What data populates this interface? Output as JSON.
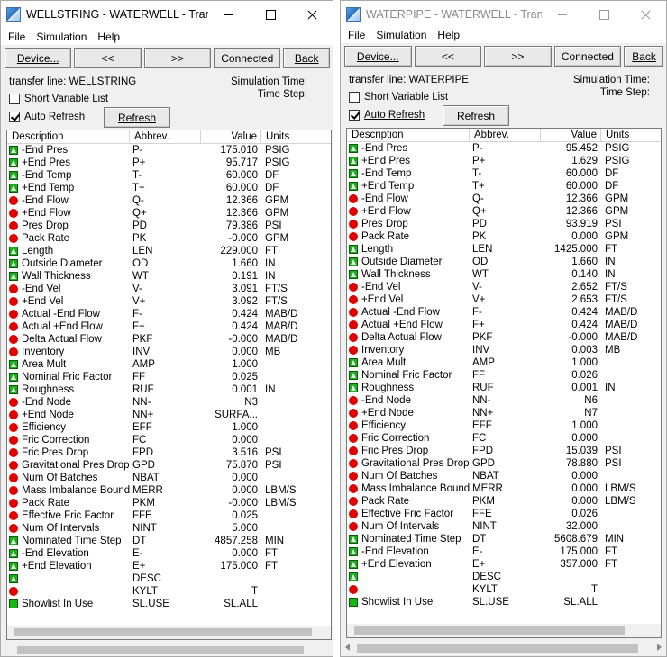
{
  "left": {
    "title": "WELLSTRING - WATERWELL - Trans",
    "menu": [
      "File",
      "Simulation",
      "Help"
    ],
    "toolbar": {
      "device": "Device...",
      "prev": "<<",
      "next": ">>",
      "connected": "Connected",
      "back": "Back"
    },
    "transfer_line": "transfer line: WELLSTRING",
    "sim_time_label": "Simulation Time:",
    "time_step_label": "Time Step:",
    "short_list_label": "Short Variable List",
    "short_list_checked": false,
    "auto_refresh_label": "Auto Refresh",
    "auto_refresh_checked": true,
    "refresh_label": "Refresh",
    "columns": [
      "Description",
      "Abbrev.",
      "Value",
      "Units"
    ],
    "rows": [
      {
        "icon": "param",
        "desc": "-End Pres",
        "abbr": "P-",
        "val": "175.010",
        "unit": "PSIG"
      },
      {
        "icon": "param",
        "desc": "+End Pres",
        "abbr": "P+",
        "val": "95.717",
        "unit": "PSIG"
      },
      {
        "icon": "param",
        "desc": "-End Temp",
        "abbr": "T-",
        "val": "60.000",
        "unit": "DF"
      },
      {
        "icon": "param",
        "desc": "+End Temp",
        "abbr": "T+",
        "val": "60.000",
        "unit": "DF"
      },
      {
        "icon": "calc",
        "desc": "-End Flow",
        "abbr": "Q-",
        "val": "12.366",
        "unit": "GPM"
      },
      {
        "icon": "calc",
        "desc": "+End Flow",
        "abbr": "Q+",
        "val": "12.366",
        "unit": "GPM"
      },
      {
        "icon": "calc",
        "desc": "Pres Drop",
        "abbr": "PD",
        "val": "79.386",
        "unit": "PSI"
      },
      {
        "icon": "calc",
        "desc": "Pack Rate",
        "abbr": "PK",
        "val": "-0.000",
        "unit": "GPM"
      },
      {
        "icon": "param",
        "desc": "Length",
        "abbr": "LEN",
        "val": "229.000",
        "unit": "FT"
      },
      {
        "icon": "param",
        "desc": "Outside Diameter",
        "abbr": "OD",
        "val": "1.660",
        "unit": "IN"
      },
      {
        "icon": "param",
        "desc": "Wall Thickness",
        "abbr": "WT",
        "val": "0.191",
        "unit": "IN"
      },
      {
        "icon": "calc",
        "desc": "-End Vel",
        "abbr": "V-",
        "val": "3.091",
        "unit": "FT/S"
      },
      {
        "icon": "calc",
        "desc": "+End Vel",
        "abbr": "V+",
        "val": "3.092",
        "unit": "FT/S"
      },
      {
        "icon": "calc",
        "desc": "Actual -End Flow",
        "abbr": "F-",
        "val": "0.424",
        "unit": "MAB/D"
      },
      {
        "icon": "calc",
        "desc": "Actual +End Flow",
        "abbr": "F+",
        "val": "0.424",
        "unit": "MAB/D"
      },
      {
        "icon": "calc",
        "desc": "Delta Actual Flow",
        "abbr": "PKF",
        "val": "-0.000",
        "unit": "MAB/D"
      },
      {
        "icon": "calc",
        "desc": "Inventory",
        "abbr": "INV",
        "val": "0.000",
        "unit": "MB"
      },
      {
        "icon": "param",
        "desc": "Area Mult",
        "abbr": "AMP",
        "val": "1.000",
        "unit": ""
      },
      {
        "icon": "param",
        "desc": "Nominal Fric Factor",
        "abbr": "FF",
        "val": "0.025",
        "unit": ""
      },
      {
        "icon": "param",
        "desc": "Roughness",
        "abbr": "RUF",
        "val": "0.001",
        "unit": "IN"
      },
      {
        "icon": "calc",
        "desc": "-End Node",
        "abbr": "NN-",
        "val": "N3",
        "unit": ""
      },
      {
        "icon": "calc",
        "desc": "+End Node",
        "abbr": "NN+",
        "val": "SURFA...",
        "unit": ""
      },
      {
        "icon": "calc",
        "desc": "Efficiency",
        "abbr": "EFF",
        "val": "1.000",
        "unit": ""
      },
      {
        "icon": "calc",
        "desc": "Fric Correction",
        "abbr": "FC",
        "val": "0.000",
        "unit": ""
      },
      {
        "icon": "calc",
        "desc": "Fric Pres Drop",
        "abbr": "FPD",
        "val": "3.516",
        "unit": "PSI"
      },
      {
        "icon": "calc",
        "desc": "Gravitational Pres Drop",
        "abbr": "GPD",
        "val": "75.870",
        "unit": "PSI"
      },
      {
        "icon": "calc",
        "desc": "Num Of Batches",
        "abbr": "NBAT",
        "val": "0.000",
        "unit": ""
      },
      {
        "icon": "calc",
        "desc": "Mass Imbalance Bound",
        "abbr": "MERR",
        "val": "0.000",
        "unit": "LBM/S"
      },
      {
        "icon": "calc",
        "desc": "Pack Rate",
        "abbr": "PKM",
        "val": "-0.000",
        "unit": "LBM/S"
      },
      {
        "icon": "calc",
        "desc": "Effective Fric Factor",
        "abbr": "FFE",
        "val": "0.025",
        "unit": ""
      },
      {
        "icon": "calc",
        "desc": "Num Of Intervals",
        "abbr": "NINT",
        "val": "5.000",
        "unit": ""
      },
      {
        "icon": "param",
        "desc": "Nominated Time Step",
        "abbr": "DT",
        "val": "4857.258",
        "unit": "MIN"
      },
      {
        "icon": "param",
        "desc": "-End Elevation",
        "abbr": "E-",
        "val": "0.000",
        "unit": "FT"
      },
      {
        "icon": "param",
        "desc": "+End Elevation",
        "abbr": "E+",
        "val": "175.000",
        "unit": "FT"
      },
      {
        "icon": "param",
        "desc": "",
        "abbr": "DESC",
        "val": "",
        "unit": ""
      },
      {
        "icon": "calc",
        "desc": "",
        "abbr": "KYLT",
        "val": "T",
        "unit": ""
      },
      {
        "icon": "flag",
        "desc": "Showlist In Use",
        "abbr": "SL.USE",
        "val": "SL.ALL",
        "unit": ""
      }
    ]
  },
  "right": {
    "title": "WATERPIPE - WATERWELL - Trans",
    "menu": [
      "File",
      "Simulation",
      "Help"
    ],
    "toolbar": {
      "device": "Device...",
      "prev": "<<",
      "next": ">>",
      "connected": "Connected",
      "back": "Back"
    },
    "transfer_line": "transfer line: WATERPIPE",
    "sim_time_label": "Simulation Time:",
    "time_step_label": "Time Step:",
    "short_list_label": "Short Variable List",
    "short_list_checked": false,
    "auto_refresh_label": "Auto Refresh",
    "auto_refresh_checked": true,
    "refresh_label": "Refresh",
    "columns": [
      "Description",
      "Abbrev.",
      "Value",
      "Units"
    ],
    "rows": [
      {
        "icon": "param",
        "desc": "-End Pres",
        "abbr": "P-",
        "val": "95.452",
        "unit": "PSIG"
      },
      {
        "icon": "param",
        "desc": "+End Pres",
        "abbr": "P+",
        "val": "1.629",
        "unit": "PSIG"
      },
      {
        "icon": "param",
        "desc": "-End Temp",
        "abbr": "T-",
        "val": "60.000",
        "unit": "DF"
      },
      {
        "icon": "param",
        "desc": "+End Temp",
        "abbr": "T+",
        "val": "60.000",
        "unit": "DF"
      },
      {
        "icon": "calc",
        "desc": "-End Flow",
        "abbr": "Q-",
        "val": "12.366",
        "unit": "GPM"
      },
      {
        "icon": "calc",
        "desc": "+End Flow",
        "abbr": "Q+",
        "val": "12.366",
        "unit": "GPM"
      },
      {
        "icon": "calc",
        "desc": "Pres Drop",
        "abbr": "PD",
        "val": "93.919",
        "unit": "PSI"
      },
      {
        "icon": "calc",
        "desc": "Pack Rate",
        "abbr": "PK",
        "val": "0.000",
        "unit": "GPM"
      },
      {
        "icon": "param",
        "desc": "Length",
        "abbr": "LEN",
        "val": "1425.000",
        "unit": "FT"
      },
      {
        "icon": "param",
        "desc": "Outside Diameter",
        "abbr": "OD",
        "val": "1.660",
        "unit": "IN"
      },
      {
        "icon": "param",
        "desc": "Wall Thickness",
        "abbr": "WT",
        "val": "0.140",
        "unit": "IN"
      },
      {
        "icon": "calc",
        "desc": "-End Vel",
        "abbr": "V-",
        "val": "2.652",
        "unit": "FT/S"
      },
      {
        "icon": "calc",
        "desc": "+End Vel",
        "abbr": "V+",
        "val": "2.653",
        "unit": "FT/S"
      },
      {
        "icon": "calc",
        "desc": "Actual -End Flow",
        "abbr": "F-",
        "val": "0.424",
        "unit": "MAB/D"
      },
      {
        "icon": "calc",
        "desc": "Actual +End Flow",
        "abbr": "F+",
        "val": "0.424",
        "unit": "MAB/D"
      },
      {
        "icon": "calc",
        "desc": "Delta Actual Flow",
        "abbr": "PKF",
        "val": "-0.000",
        "unit": "MAB/D"
      },
      {
        "icon": "calc",
        "desc": "Inventory",
        "abbr": "INV",
        "val": "0.003",
        "unit": "MB"
      },
      {
        "icon": "param",
        "desc": "Area Mult",
        "abbr": "AMP",
        "val": "1.000",
        "unit": ""
      },
      {
        "icon": "param",
        "desc": "Nominal Fric Factor",
        "abbr": "FF",
        "val": "0.026",
        "unit": ""
      },
      {
        "icon": "param",
        "desc": "Roughness",
        "abbr": "RUF",
        "val": "0.001",
        "unit": "IN"
      },
      {
        "icon": "calc",
        "desc": "-End Node",
        "abbr": "NN-",
        "val": "N6",
        "unit": ""
      },
      {
        "icon": "calc",
        "desc": "+End Node",
        "abbr": "NN+",
        "val": "N7",
        "unit": ""
      },
      {
        "icon": "calc",
        "desc": "Efficiency",
        "abbr": "EFF",
        "val": "1.000",
        "unit": ""
      },
      {
        "icon": "calc",
        "desc": "Fric Correction",
        "abbr": "FC",
        "val": "0.000",
        "unit": ""
      },
      {
        "icon": "calc",
        "desc": "Fric Pres Drop",
        "abbr": "FPD",
        "val": "15.039",
        "unit": "PSI"
      },
      {
        "icon": "calc",
        "desc": "Gravitational Pres Drop",
        "abbr": "GPD",
        "val": "78.880",
        "unit": "PSI"
      },
      {
        "icon": "calc",
        "desc": "Num Of Batches",
        "abbr": "NBAT",
        "val": "0.000",
        "unit": ""
      },
      {
        "icon": "calc",
        "desc": "Mass Imbalance Bound",
        "abbr": "MERR",
        "val": "0.000",
        "unit": "LBM/S"
      },
      {
        "icon": "calc",
        "desc": "Pack Rate",
        "abbr": "PKM",
        "val": "0.000",
        "unit": "LBM/S"
      },
      {
        "icon": "calc",
        "desc": "Effective Fric Factor",
        "abbr": "FFE",
        "val": "0.026",
        "unit": ""
      },
      {
        "icon": "calc",
        "desc": "Num Of Intervals",
        "abbr": "NINT",
        "val": "32.000",
        "unit": ""
      },
      {
        "icon": "param",
        "desc": "Nominated Time Step",
        "abbr": "DT",
        "val": "5608.679",
        "unit": "MIN"
      },
      {
        "icon": "param",
        "desc": "-End Elevation",
        "abbr": "E-",
        "val": "175.000",
        "unit": "FT"
      },
      {
        "icon": "param",
        "desc": "+End Elevation",
        "abbr": "E+",
        "val": "357.000",
        "unit": "FT"
      },
      {
        "icon": "param",
        "desc": "",
        "abbr": "DESC",
        "val": "",
        "unit": ""
      },
      {
        "icon": "calc",
        "desc": "",
        "abbr": "KYLT",
        "val": "T",
        "unit": ""
      },
      {
        "icon": "flag",
        "desc": "Showlist In Use",
        "abbr": "SL.USE",
        "val": "SL.ALL",
        "unit": ""
      }
    ]
  }
}
